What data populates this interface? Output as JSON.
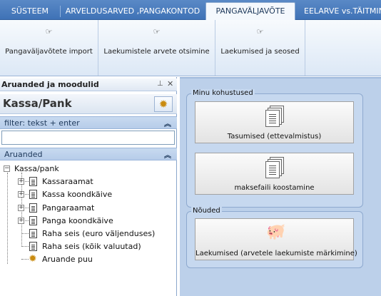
{
  "tabs": [
    {
      "label": "SÜSTEEM",
      "active": false
    },
    {
      "label": "ARVELDUSARVED ,PANGAKONTOD",
      "active": false
    },
    {
      "label": "PANGAVÄLJAVÕTE",
      "active": true
    },
    {
      "label": "EELARVE vs.TÄITMINE",
      "active": false
    }
  ],
  "ribbon": {
    "buttons": [
      {
        "label": "Pangaväljavõtete import",
        "icon": "hand-pointer-icon"
      },
      {
        "label": "Laekumistele arvete otsimine",
        "icon": "hand-pointer-icon"
      },
      {
        "label": "Laekumised ja seosed",
        "icon": "hand-pointer-icon"
      }
    ]
  },
  "left_panel": {
    "title": "Aruanded ja moodulid",
    "pin_icon": "pin-icon",
    "close_icon": "close-icon",
    "module_title": "Kassa/Pank",
    "filter_label": "filter: tekst + enter",
    "filter_value": "",
    "reports_label": "Aruanded",
    "tree": {
      "root": "Kassa/pank",
      "items": [
        {
          "label": "Kassaraamat",
          "expandable": true,
          "icon": "document-icon"
        },
        {
          "label": "Kassa koondkäive",
          "expandable": true,
          "icon": "document-icon"
        },
        {
          "label": "Pangaraamat",
          "expandable": true,
          "icon": "document-icon"
        },
        {
          "label": "Panga koondkäive",
          "expandable": true,
          "icon": "document-icon"
        },
        {
          "label": "Raha seis (euro väljenduses)",
          "expandable": false,
          "icon": "document-icon"
        },
        {
          "label": "Raha seis (kõik valuutad)",
          "expandable": false,
          "icon": "document-icon"
        },
        {
          "label": "Aruande puu",
          "expandable": false,
          "icon": "gear-icon"
        }
      ]
    }
  },
  "content": {
    "groups": [
      {
        "title": "Minu kohustused",
        "buttons": [
          {
            "label": "Tasumised (ettevalmistus)",
            "icon": "document-stack-icon"
          },
          {
            "label": "maksefaili koostamine",
            "icon": "document-stack-icon"
          }
        ]
      },
      {
        "title": "Nõuded",
        "buttons": [
          {
            "label": "Laekumised (arvetele laekumiste märkimine)",
            "icon": "piggy-bank-icon"
          }
        ]
      }
    ]
  }
}
